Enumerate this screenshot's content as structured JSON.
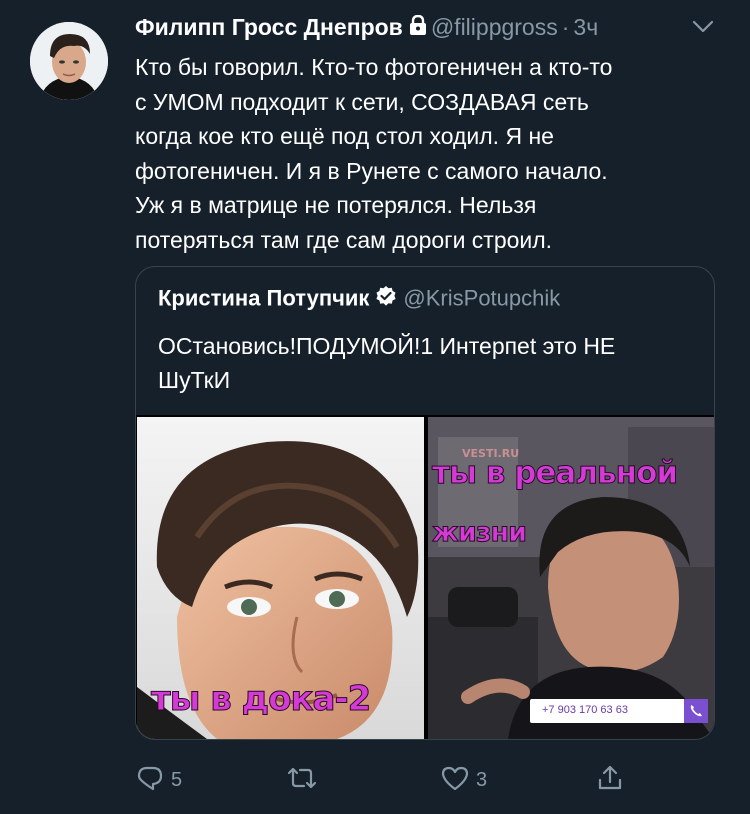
{
  "tweet": {
    "author": {
      "display_name": "Филипп Гросс Днепров",
      "handle": "@filippgross",
      "time": "3ч",
      "protected": true
    },
    "text": "Кто бы говорил. Кто-то фотогеничен а кто-то\nс УМОМ подходит к сети, СОЗДАВАЯ сеть\nкогда кое кто ещё под стол ходил. Я не\nфотогеничен. И я в Рунете с самого начало.\nУж я в матрице не потерялся. Нельзя\nпотеряться там где сам дороги строил.",
    "quoted": {
      "author": {
        "display_name": "Кристина Потупчик",
        "handle": "@KrisPotupchik",
        "verified": true
      },
      "text": "ОСтановись!ПОДУМОЙ!1 Интерпеt это НЕ\nШуТкИ",
      "media": {
        "left_caption": "ты в дока-2",
        "right_caption_line1": "ты в реальной",
        "right_caption_line2": "жизни",
        "right_watermark": "VESTI.RU",
        "right_phone": "+7 903 170 63 63"
      }
    },
    "actions": {
      "reply_count": "5",
      "retweet_count": "",
      "like_count": "3"
    }
  },
  "colors": {
    "background": "#15202b",
    "secondary_text": "#8899a6",
    "border": "#38444d",
    "caption": "#d63ad6"
  },
  "icons": [
    "lock-icon",
    "chevron-down-icon",
    "verified-badge-icon",
    "reply-icon",
    "retweet-icon",
    "like-icon",
    "share-icon"
  ]
}
